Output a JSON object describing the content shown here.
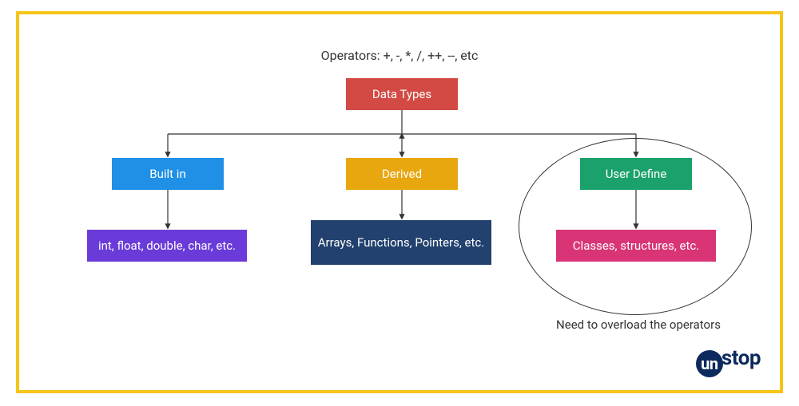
{
  "chart_data": {
    "type": "tree",
    "title": "Operators: +, -, *, /, ++, --, etc",
    "root": {
      "label": "Data Types",
      "color": "#d24a43"
    },
    "level1": [
      {
        "label": "Built in",
        "color": "#1f90e5"
      },
      {
        "label": "Derived",
        "color": "#e8a70f"
      },
      {
        "label": "User Define",
        "color": "#1ba16b"
      }
    ],
    "leaves": [
      {
        "label": "int, float, double, char, etc.",
        "color": "#6a3bd9"
      },
      {
        "label": "Arrays, Functions, Pointers, etc.",
        "color": "#22416e"
      },
      {
        "label": "Classes, structures, etc.",
        "color": "#d93576"
      }
    ],
    "highlight": {
      "node_index": 2,
      "caption": "Need to overload the operators"
    }
  },
  "brand": {
    "part1": "un",
    "part2": "stop"
  }
}
